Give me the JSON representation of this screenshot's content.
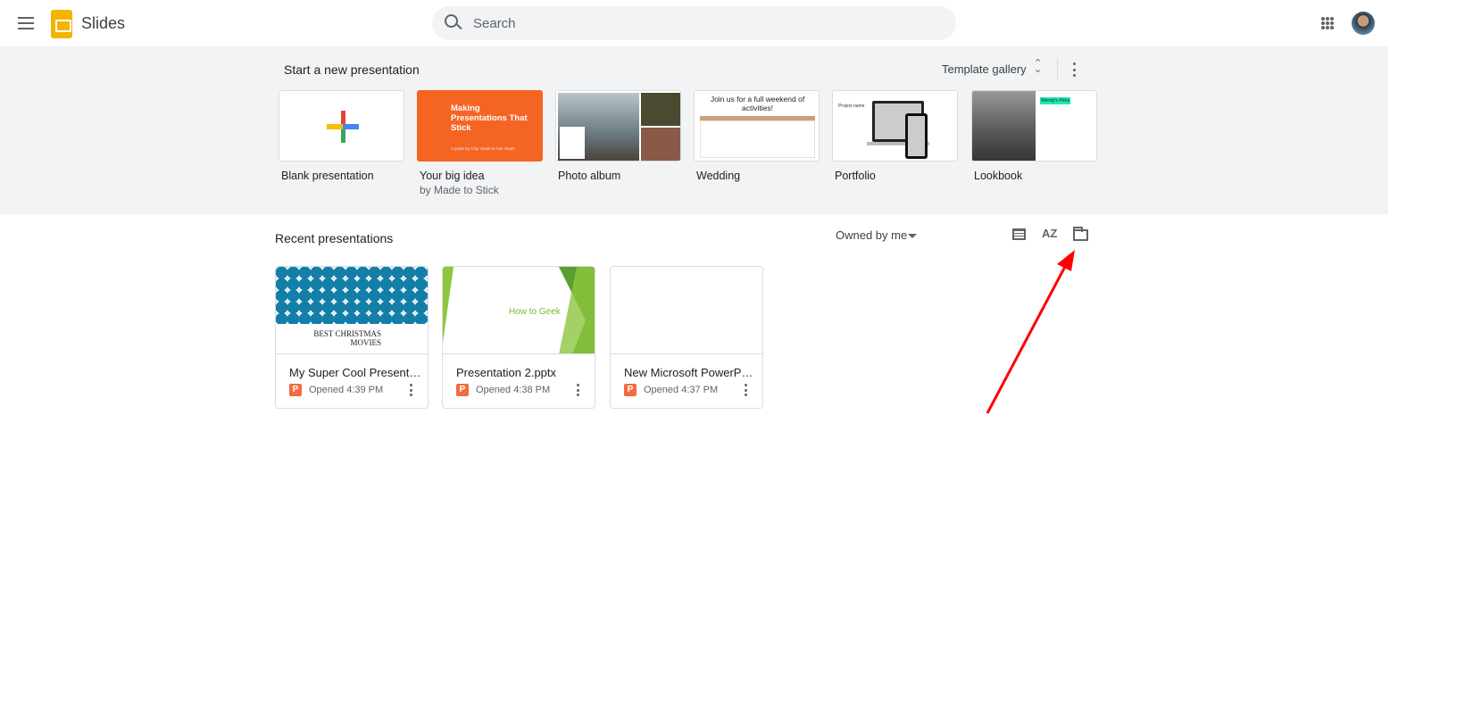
{
  "header": {
    "app_name": "Slides",
    "search_placeholder": "Search"
  },
  "templates": {
    "title": "Start a new presentation",
    "gallery_label": "Template gallery",
    "items": [
      {
        "label": "Blank presentation"
      },
      {
        "label": "Your big idea",
        "sub": "by Made to Stick",
        "thumb_title": "Making Presentations That Stick",
        "thumb_sub": "A guide by Chip Heath & Dan Heath"
      },
      {
        "label": "Photo album"
      },
      {
        "label": "Wedding",
        "thumb_title": "Join us for a full weekend of activities!"
      },
      {
        "label": "Portfolio",
        "thumb_title": "Project name"
      },
      {
        "label": "Lookbook",
        "thumb_title": "Wendy's Picks"
      }
    ]
  },
  "recent": {
    "title": "Recent presentations",
    "owner_filter": "Owned by me",
    "sort_label": "AZ",
    "docs": [
      {
        "title": "My Super Cool Presentati...",
        "opened": "Opened 4:39 PM",
        "thumb_text": "BEST CHRISTMAS MOVIES",
        "type": "P"
      },
      {
        "title": "Presentation 2.pptx",
        "opened": "Opened 4:38 PM",
        "thumb_text": "How to Geek",
        "type": "P"
      },
      {
        "title": "New Microsoft PowerPoi...",
        "opened": "Opened 4:37 PM",
        "type": "P"
      }
    ]
  },
  "colors": {
    "annotation_arrow": "#ff0000",
    "ppt": "#f16c3e",
    "slides": "#f4b400"
  }
}
